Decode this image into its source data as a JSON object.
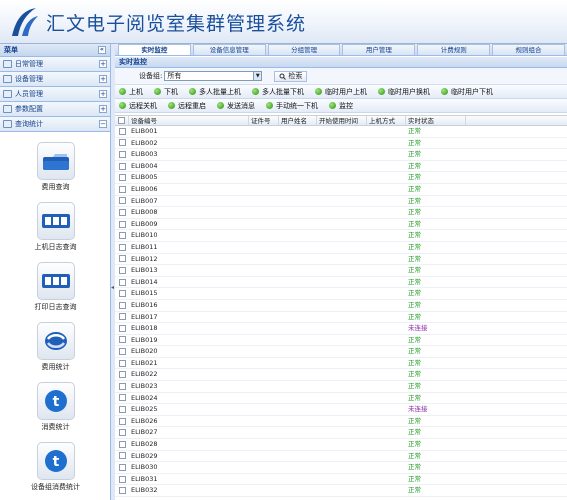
{
  "app": {
    "title": "汇文电子阅览室集群管理系统"
  },
  "sidebar": {
    "header": "菜单",
    "collapse": "«",
    "menu": [
      {
        "label": "日常管理",
        "toggle": "+"
      },
      {
        "label": "设备管理",
        "toggle": "+"
      },
      {
        "label": "人员管理",
        "toggle": "+"
      },
      {
        "label": "参数配置",
        "toggle": "+"
      },
      {
        "label": "查询统计",
        "toggle": "−"
      }
    ],
    "shortcuts": [
      {
        "label": "费用查询",
        "icon": "folder-icon"
      },
      {
        "label": "上机日志查询",
        "icon": "log-icon"
      },
      {
        "label": "打印日志查询",
        "icon": "print-log-icon"
      },
      {
        "label": "费用统计",
        "icon": "refresh-icon"
      },
      {
        "label": "消费统计",
        "icon": "twitter-icon"
      },
      {
        "label": "设备组消费统计",
        "icon": "twitter-icon"
      }
    ]
  },
  "tabs": [
    "实时监控",
    "设备信息管理",
    "分组管理",
    "用户管理",
    "计费规则",
    "规则组合"
  ],
  "panel_title": "实时监控",
  "filter": {
    "label": "设备组:",
    "value": "所有",
    "search_label": "检索"
  },
  "toolbar1": [
    "上机",
    "下机",
    "多人批量上机",
    "多人批量下机",
    "临时用户上机",
    "临时用户换机",
    "临时用户下机"
  ],
  "toolbar2": [
    "远程关机",
    "远程重启",
    "发送消息",
    "手动统一下机",
    "监控"
  ],
  "columns": [
    "设备编号",
    "证件号",
    "用户姓名",
    "开始使用时间",
    "上机方式",
    "实时状态"
  ],
  "rows": [
    {
      "id": "ELIB001",
      "status": "正常"
    },
    {
      "id": "ELIB002",
      "status": "正常"
    },
    {
      "id": "ELIB003",
      "status": "正常"
    },
    {
      "id": "ELIB004",
      "status": "正常"
    },
    {
      "id": "ELIB005",
      "status": "正常"
    },
    {
      "id": "ELIB006",
      "status": "正常"
    },
    {
      "id": "ELIB007",
      "status": "正常"
    },
    {
      "id": "ELIB008",
      "status": "正常"
    },
    {
      "id": "ELIB009",
      "status": "正常"
    },
    {
      "id": "ELIB010",
      "status": "正常"
    },
    {
      "id": "ELIB011",
      "status": "正常"
    },
    {
      "id": "ELIB012",
      "status": "正常"
    },
    {
      "id": "ELIB013",
      "status": "正常"
    },
    {
      "id": "ELIB014",
      "status": "正常"
    },
    {
      "id": "ELIB015",
      "status": "正常"
    },
    {
      "id": "ELIB016",
      "status": "正常"
    },
    {
      "id": "ELIB017",
      "status": "正常"
    },
    {
      "id": "ELIB018",
      "status": "未连接"
    },
    {
      "id": "ELIB019",
      "status": "正常"
    },
    {
      "id": "ELIB020",
      "status": "正常"
    },
    {
      "id": "ELIB021",
      "status": "正常"
    },
    {
      "id": "ELIB022",
      "status": "正常"
    },
    {
      "id": "ELIB023",
      "status": "正常"
    },
    {
      "id": "ELIB024",
      "status": "正常"
    },
    {
      "id": "ELIB025",
      "status": "未连接"
    },
    {
      "id": "ELIB026",
      "status": "正常"
    },
    {
      "id": "ELIB027",
      "status": "正常"
    },
    {
      "id": "ELIB028",
      "status": "正常"
    },
    {
      "id": "ELIB029",
      "status": "正常"
    },
    {
      "id": "ELIB030",
      "status": "正常"
    },
    {
      "id": "ELIB031",
      "status": "正常"
    },
    {
      "id": "ELIB032",
      "status": "正常"
    }
  ],
  "colors": {
    "accent": "#15428b",
    "ok": "#1f9a1f",
    "offline": "#8a2aa8"
  }
}
